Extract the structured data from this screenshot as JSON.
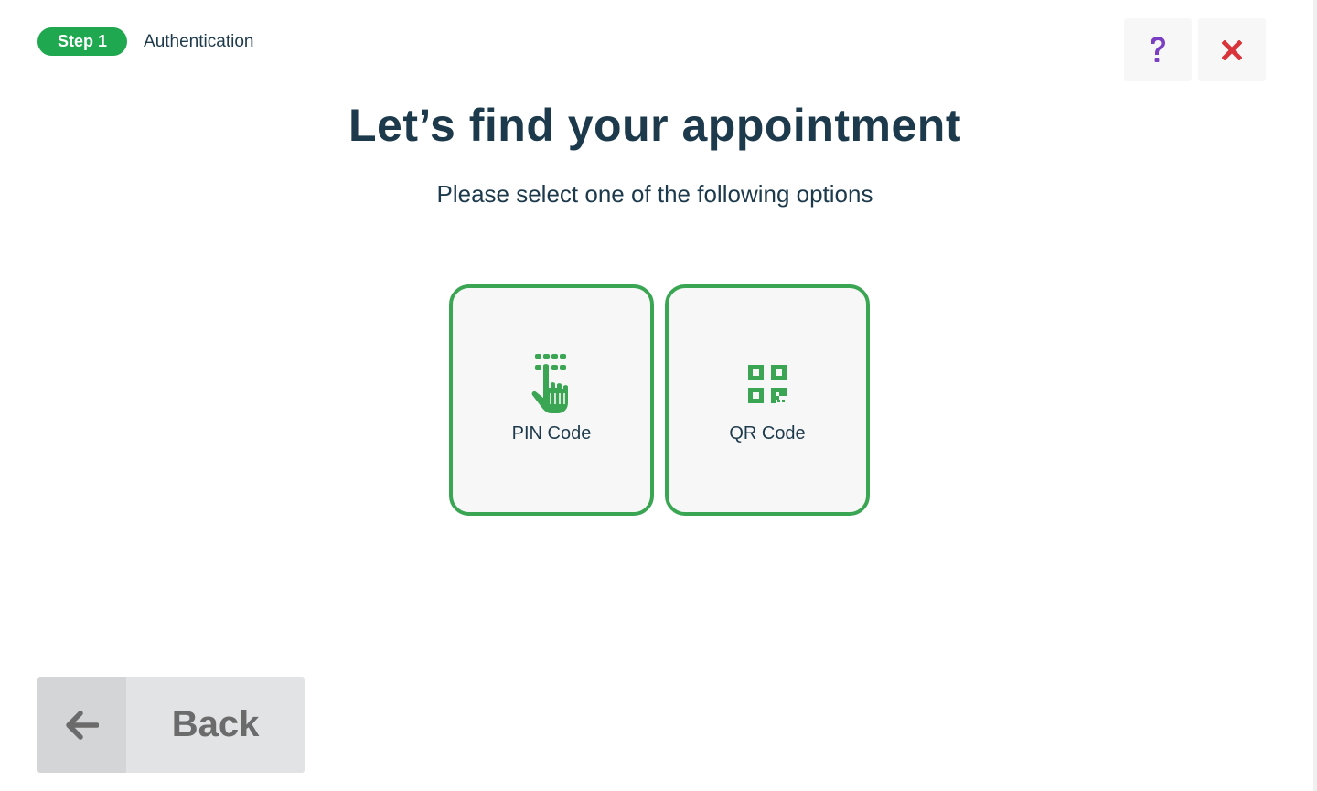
{
  "header": {
    "step_badge": "Step 1",
    "step_label": "Authentication",
    "help_icon": "question-mark-icon",
    "close_icon": "close-x-icon"
  },
  "main": {
    "title": "Let’s find your appointment",
    "subtitle": "Please select one of the following options",
    "options": [
      {
        "label": "PIN Code",
        "icon": "keypad-hand-icon"
      },
      {
        "label": "QR Code",
        "icon": "qr-code-icon"
      }
    ]
  },
  "footer": {
    "back_label": "Back",
    "back_icon": "arrow-left-icon"
  },
  "colors": {
    "brand_green": "#1fa84f",
    "card_border": "#3aa653",
    "text_dark": "#1d3a4c",
    "help_purple": "#7b3fc4",
    "close_red": "#d9343a"
  }
}
